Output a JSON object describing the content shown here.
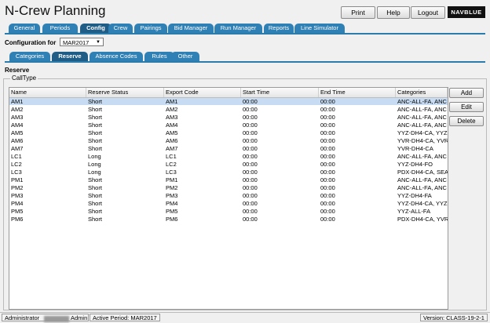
{
  "app": {
    "title": "N-Crew Planning",
    "logo": "NAVBLUE"
  },
  "top_buttons": {
    "print": "Print",
    "help": "Help",
    "logout": "Logout"
  },
  "main_tabs": [
    "General",
    "Periods",
    "Config",
    "Crew",
    "Pairings",
    "Bid Manager",
    "Run Manager",
    "Reports",
    "Line Simulator"
  ],
  "main_tab_active": "Config",
  "config": {
    "label": "Configuration for",
    "selected": "MAR2017"
  },
  "sub_tabs": [
    "Categories",
    "Reserve",
    "Absence Codes",
    "Rules",
    "Other"
  ],
  "sub_tab_active": "Reserve",
  "section": {
    "title": "Reserve",
    "group": "CallType"
  },
  "table": {
    "columns": [
      "Name",
      "Reserve Status",
      "Export Code",
      "Start Time",
      "End Time",
      "Categories"
    ],
    "rows": [
      [
        "AM1",
        "Short",
        "AM1",
        "00:00",
        "00:00",
        "ANC-ALL-FA, ANC"
      ],
      [
        "AM2",
        "Short",
        "AM2",
        "00:00",
        "00:00",
        "ANC-ALL-FA, ANC"
      ],
      [
        "AM3",
        "Short",
        "AM3",
        "00:00",
        "00:00",
        "ANC-ALL-FA, ANC"
      ],
      [
        "AM4",
        "Short",
        "AM4",
        "00:00",
        "00:00",
        "ANC-ALL-FA, ANC"
      ],
      [
        "AM5",
        "Short",
        "AM5",
        "00:00",
        "00:00",
        "YYZ-DH4-CA, YYZ"
      ],
      [
        "AM6",
        "Short",
        "AM6",
        "00:00",
        "00:00",
        "YVR-DH4-CA, YVR"
      ],
      [
        "AM7",
        "Short",
        "AM7",
        "00:00",
        "00:00",
        "YVR-DH4-CA"
      ],
      [
        "LC1",
        "Long",
        "LC1",
        "00:00",
        "00:00",
        "ANC-ALL-FA, ANC"
      ],
      [
        "LC2",
        "Long",
        "LC2",
        "00:00",
        "00:00",
        "YYZ-DH4-FO"
      ],
      [
        "LC3",
        "Long",
        "LC3",
        "00:00",
        "00:00",
        "PDX-DH4-CA, SEA"
      ],
      [
        "PM1",
        "Short",
        "PM1",
        "00:00",
        "00:00",
        "ANC-ALL-FA, ANC"
      ],
      [
        "PM2",
        "Short",
        "PM2",
        "00:00",
        "00:00",
        "ANC-ALL-FA, ANC"
      ],
      [
        "PM3",
        "Short",
        "PM3",
        "00:00",
        "00:00",
        "YYZ-DH4-FA"
      ],
      [
        "PM4",
        "Short",
        "PM4",
        "00:00",
        "00:00",
        "YYZ-DH4-CA, YYZ"
      ],
      [
        "PM5",
        "Short",
        "PM5",
        "00:00",
        "00:00",
        "YYZ-ALL-FA"
      ],
      [
        "PM6",
        "Short",
        "PM6",
        "00:00",
        "00:00",
        "PDX-DH4-CA, YVR"
      ]
    ],
    "selected_row": 0
  },
  "side_buttons": {
    "add": "Add",
    "edit": "Edit",
    "delete": "Delete"
  },
  "status": {
    "role": "Administrator",
    "user": "Admin",
    "period": "Active Period: MAR2017",
    "version": "Version: CLASS-19-2-1"
  },
  "colors": {
    "tab": "#2f80b4",
    "tab_active": "#1f5d87",
    "selected_row": "#c7dcf2"
  }
}
